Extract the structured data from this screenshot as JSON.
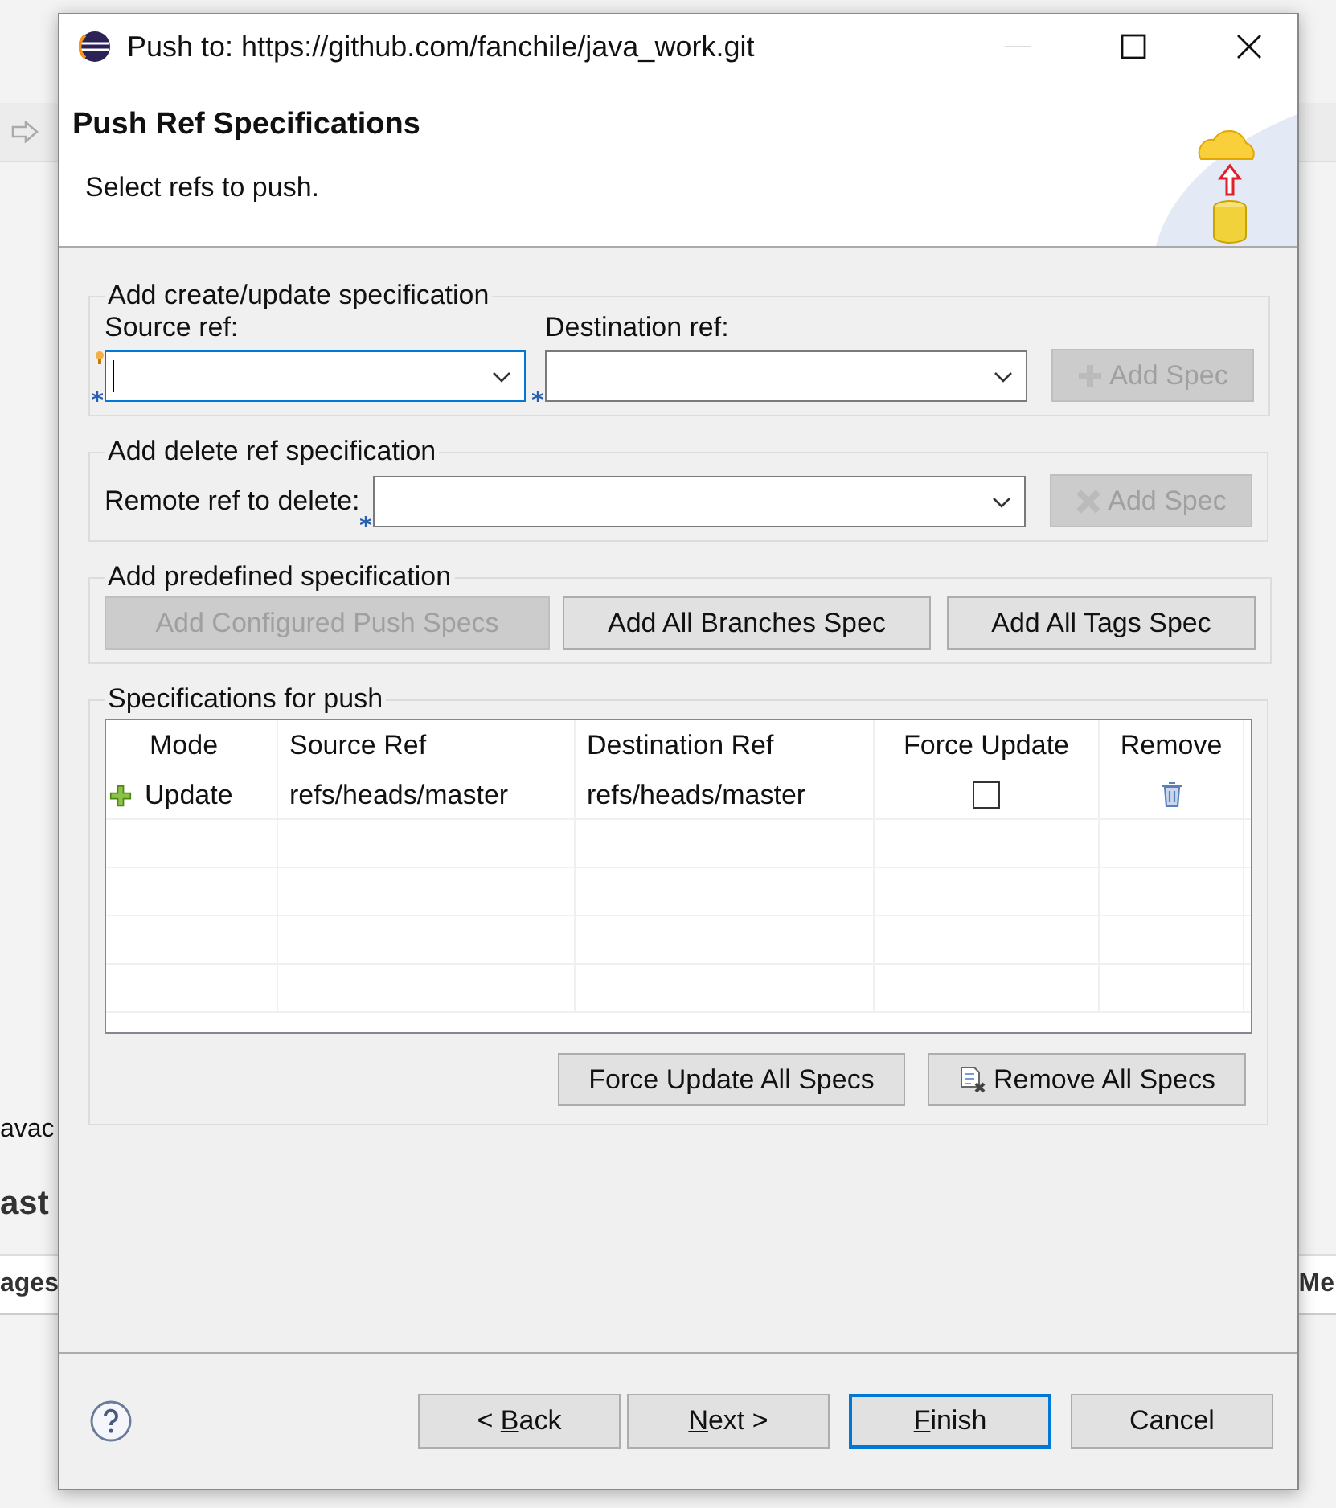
{
  "background": {
    "left_tab": "avac",
    "left_heading": "ast",
    "left_column": "ages",
    "right_column": "Me"
  },
  "window": {
    "title": "Push to: https://github.com/fanchile/java_work.git"
  },
  "header": {
    "title": "Push Ref Specifications",
    "subtitle": "Select refs to push."
  },
  "create_group": {
    "title": "Add create/update specification",
    "fields": [
      {
        "label": "Source ref:",
        "focused": true,
        "hint": true,
        "required": true
      },
      {
        "label": "Destination ref:",
        "focused": false,
        "hint": false,
        "required": true
      }
    ],
    "button": {
      "label": "Add Spec",
      "disabled": true
    }
  },
  "delete_group": {
    "title": "Add delete ref specification",
    "field": {
      "label": "Remote ref to delete:",
      "focused": false,
      "required": true
    },
    "button": {
      "label": "Add Spec",
      "disabled": true
    }
  },
  "predefined_group": {
    "title": "Add predefined specification",
    "buttons": [
      {
        "label": "Add Configured Push Specs",
        "disabled": true
      },
      {
        "label": "Add All Branches Spec",
        "disabled": false
      },
      {
        "label": "Add All Tags Spec",
        "disabled": false
      }
    ]
  },
  "specs_group": {
    "title": "Specifications for push",
    "table": {
      "columns": [
        "Mode",
        "Source Ref",
        "Destination Ref",
        "Force Update",
        "Remove"
      ],
      "rows": [
        {
          "mode": "Update",
          "source": "refs/heads/master",
          "destination": "refs/heads/master",
          "force_update": false
        }
      ]
    },
    "buttons": [
      {
        "label": "Force Update All Specs"
      },
      {
        "label": "Remove All Specs"
      }
    ]
  },
  "footer": {
    "buttons": [
      {
        "before": "< ",
        "key": "B",
        "after": "ack",
        "default": false
      },
      {
        "key": "N",
        "after": "ext >",
        "default": false
      },
      {
        "key": "F",
        "after": "inish",
        "default": true
      },
      {
        "before": "Cancel",
        "default": false
      }
    ]
  }
}
